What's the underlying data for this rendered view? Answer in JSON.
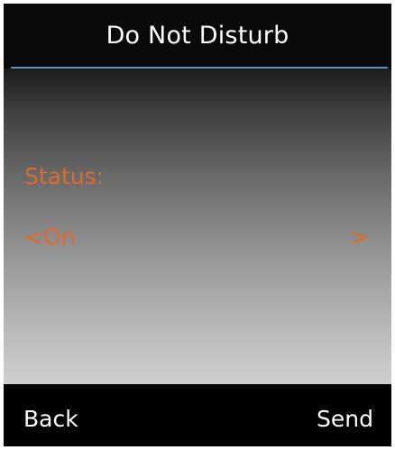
{
  "screen": {
    "title": "Do Not Disturb"
  },
  "status": {
    "label": "Status:",
    "value_display": "<On",
    "next_arrow": ">"
  },
  "softkeys": {
    "left": "Back",
    "right": "Send"
  },
  "colors": {
    "accent": "#e06a2a",
    "divider": "#5b8fbf",
    "background": "#000000",
    "text": "#ffffff"
  }
}
